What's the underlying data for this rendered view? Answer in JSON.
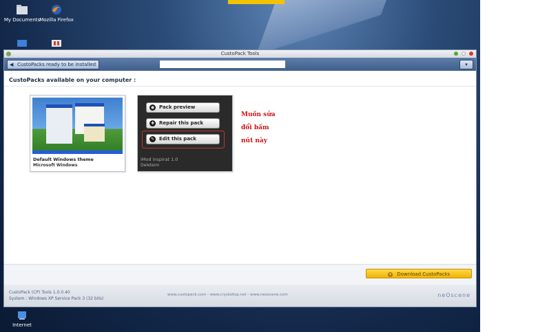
{
  "desktop": {
    "icons": [
      {
        "label": "My Documents",
        "icon": "folder-icon"
      },
      {
        "label": "Mozilla Firefox",
        "icon": "firefox-icon"
      },
      {
        "label": "",
        "icon": "computer-icon"
      },
      {
        "label": "",
        "icon": "app-icon"
      },
      {
        "label": "Internet",
        "icon": "internet-icon"
      }
    ]
  },
  "window": {
    "title": "CustoPack Tools",
    "back_label": "CustoPacks ready to be installed",
    "menu_label": "",
    "section_title": "CustoPacks available on your computer :",
    "packs": [
      {
        "name": "Default Windows theme",
        "author": "Microsoft Windows"
      },
      {
        "name": "iMod inspirat 1.0",
        "author": "Deleteim"
      }
    ],
    "pack_actions": [
      "Pack preview",
      "Repair this pack",
      "Edit this pack"
    ],
    "annotation": [
      "Muốn sửa",
      "đổi bấm",
      "nút này"
    ],
    "download_label": "Download CustoPacks",
    "version": "CustoPack (CP) Tools 1.0.0.40",
    "system": "System : Windows XP Service Pack 3 (32 bits)",
    "links": "www.custopack.com - www.crystaltop.net - www.neoscene.com",
    "brand": "neOscene"
  },
  "colors": {
    "accent": "#f0b400",
    "toolbar": "#4a6a96",
    "annotation": "#cc1111"
  }
}
